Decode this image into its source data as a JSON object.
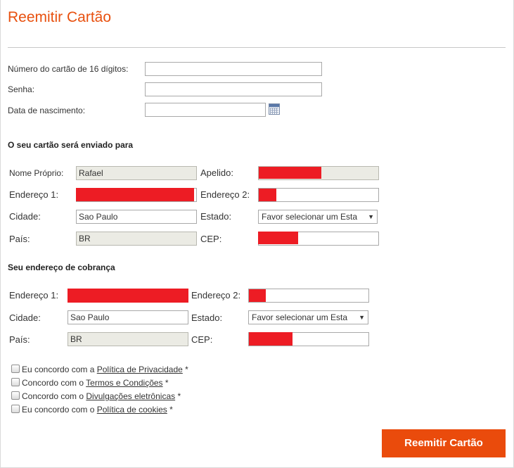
{
  "page": {
    "title": "Reemitir Cartão"
  },
  "card": {
    "number_label": "Número do cartão de 16 dígitos:",
    "number_value": "",
    "password_label": "Senha:",
    "password_value": "",
    "birthdate_label": "Data de nascimento:",
    "birthdate_value": ""
  },
  "shipping": {
    "section_title": "O seu cartão será enviado para",
    "first_name_label": "Nome Próprio:",
    "first_name_value": "Rafael",
    "last_name_label": "Apelido:",
    "address1_label": "Endereço 1:",
    "address2_label": "Endereço 2:",
    "city_label": "Cidade:",
    "city_value": "Sao Paulo",
    "state_label": "Estado:",
    "state_value": "Favor selecionar um Esta",
    "country_label": "País:",
    "country_value": "BR",
    "zip_label": "CEP:"
  },
  "billing": {
    "section_title": "Seu endereço de cobrança",
    "address1_label": "Endereço 1:",
    "address2_label": "Endereço 2:",
    "city_label": "Cidade:",
    "city_value": "Sao Paulo",
    "state_label": "Estado:",
    "state_value": "Favor selecionar um Esta",
    "country_label": "País:",
    "country_value": "BR",
    "zip_label": "CEP:"
  },
  "agreements": [
    {
      "prefix": "Eu concordo com a ",
      "link": "Política de Privacidade",
      "suffix": " *"
    },
    {
      "prefix": "Concordo com o ",
      "link": "Termos e Condições",
      "suffix": " *"
    },
    {
      "prefix": "Concordo com o ",
      "link": "Divulgações eletrônicas",
      "suffix": " *"
    },
    {
      "prefix": "Eu concordo com o ",
      "link": "Política de cookies",
      "suffix": " *"
    }
  ],
  "actions": {
    "submit_label": "Reemitir Cartão"
  },
  "colors": {
    "accent": "#e8500e",
    "button": "#ea4b0c",
    "redaction": "#ed1c24"
  }
}
